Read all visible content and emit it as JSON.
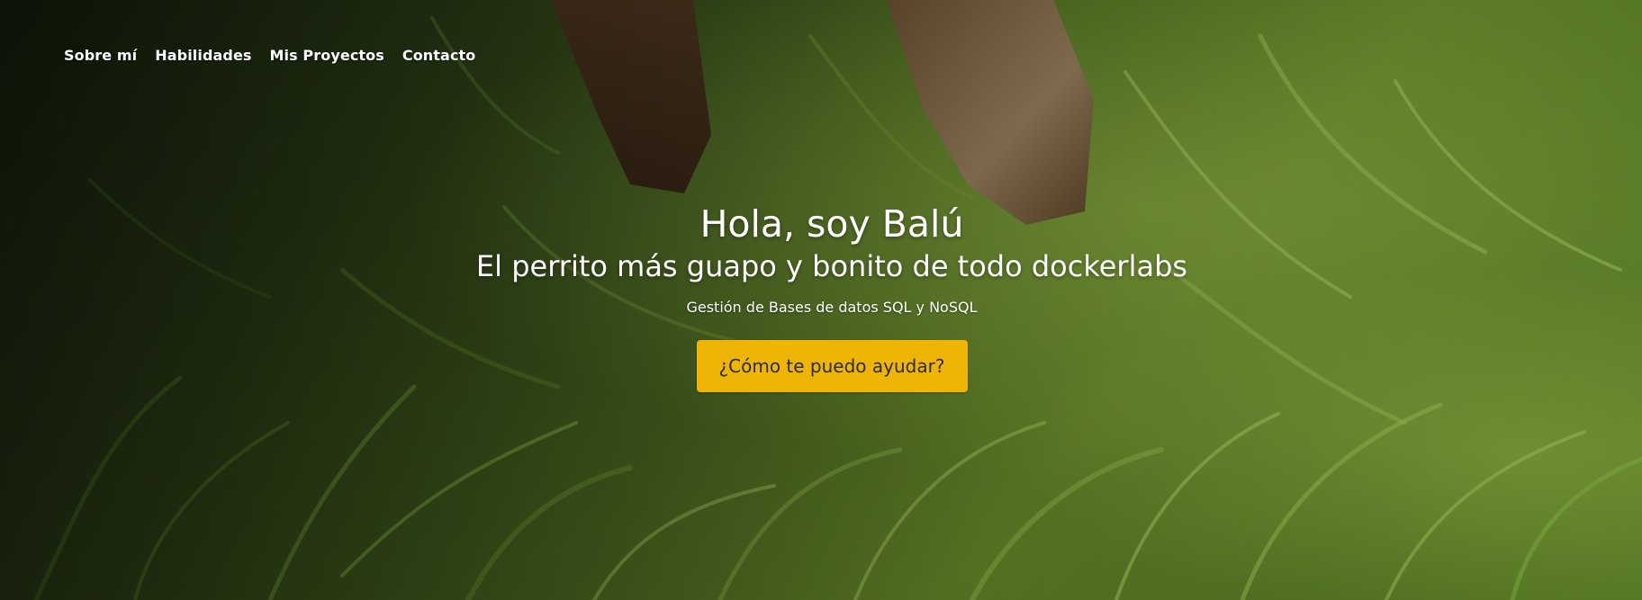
{
  "nav": {
    "items": [
      {
        "label": "Sobre mí"
      },
      {
        "label": "Habilidades"
      },
      {
        "label": "Mis Proyectos"
      },
      {
        "label": "Contacto"
      }
    ]
  },
  "hero": {
    "title": "Hola, soy Balú",
    "subtitle": "El perrito más guapo y bonito de todo dockerlabs",
    "tagline": "Gestión de Bases de datos SQL y NoSQL",
    "cta_label": "¿Cómo te puedo ayudar?",
    "background_image": "dog-in-grass-photo"
  },
  "colors": {
    "cta_background": "#efb506",
    "cta_text": "#2b2b2b",
    "text": "#ffffff",
    "grass_dark": "#2a3d14",
    "grass_light": "#7fa83a"
  }
}
